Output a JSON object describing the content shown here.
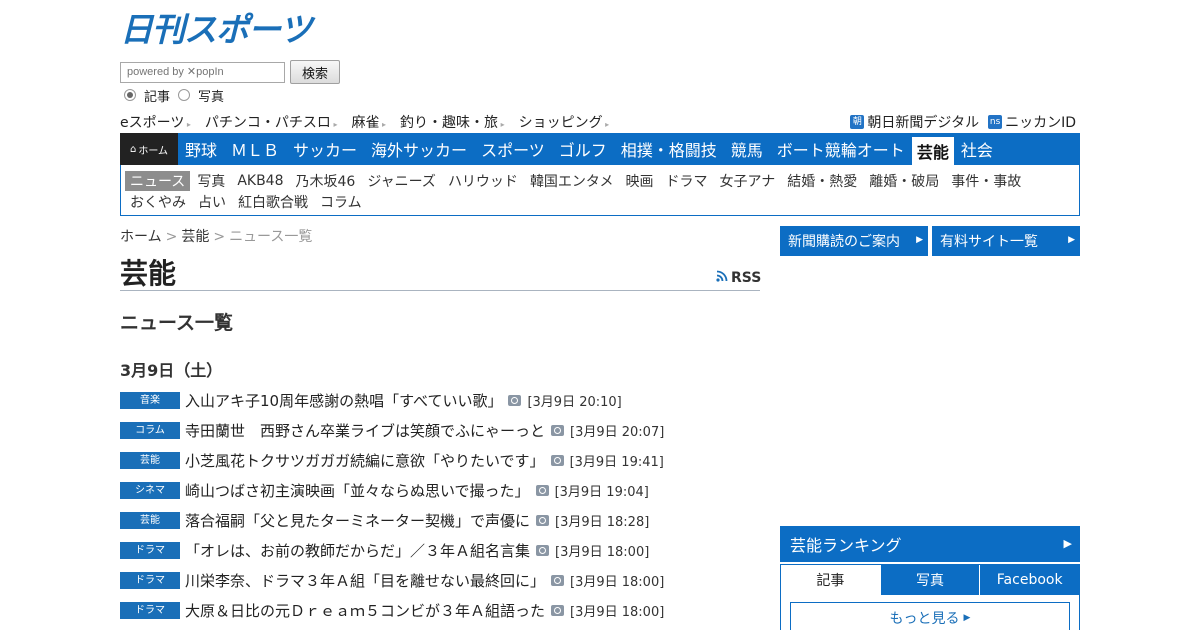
{
  "logo": {
    "text": "日刊スポーツ"
  },
  "search": {
    "placeholder": "powered by ✕popIn",
    "button_label": "検索"
  },
  "search_type": {
    "options": [
      "記事",
      "写真"
    ],
    "selected": "記事"
  },
  "util_links": [
    "eスポーツ",
    "パチンコ・パチスロ",
    "麻雀",
    "釣り・趣味・旅",
    "ショッピング"
  ],
  "util_right": [
    {
      "icon": "朝",
      "label": "朝日新聞デジタル"
    },
    {
      "icon": "ns",
      "label": "ニッカンID"
    }
  ],
  "global_nav": {
    "home_label": "ホーム",
    "items": [
      "野球",
      "ＭＬＢ",
      "サッカー",
      "海外サッカー",
      "スポーツ",
      "ゴルフ",
      "相撲・格闘技",
      "競馬",
      "ボート競輪オート",
      "芸能",
      "社会"
    ],
    "active": "芸能"
  },
  "sub_nav": {
    "row1": [
      "ニュース",
      "写真",
      "AKB48",
      "乃木坂46",
      "ジャニーズ",
      "ハリウッド",
      "韓国エンタメ",
      "映画",
      "ドラマ",
      "女子アナ",
      "結婚・熱愛",
      "離婚・破局",
      "事件・事故"
    ],
    "row2": [
      "おくやみ",
      "占い",
      "紅白歌合戦",
      "コラム"
    ],
    "active": "ニュース"
  },
  "breadcrumb": {
    "home": "ホーム",
    "section": "芸能",
    "current": "ニュース一覧",
    "separator": ">"
  },
  "page": {
    "title": "芸能",
    "rss_label": "RSS",
    "section_title": "ニュース一覧",
    "date_heading": "3月9日（土）"
  },
  "news": [
    {
      "category": "音楽",
      "headline": "入山アキ子10周年感謝の熱唱「すべていい歌」",
      "time": "[3月9日 20:10]"
    },
    {
      "category": "コラム",
      "headline": "寺田蘭世　西野さん卒業ライブは笑顔でふにゃーっと",
      "time": "[3月9日 20:07]"
    },
    {
      "category": "芸能",
      "headline": "小芝風花トクサツガガガ続編に意欲「やりたいです」",
      "time": "[3月9日 19:41]"
    },
    {
      "category": "シネマ",
      "headline": "崎山つばさ初主演映画「並々ならぬ思いで撮った」",
      "time": "[3月9日 19:04]"
    },
    {
      "category": "芸能",
      "headline": "落合福嗣「父と見たターミネーター契機」で声優に",
      "time": "[3月9日 18:28]"
    },
    {
      "category": "ドラマ",
      "headline": "「オレは、お前の教師だからだ」／３年Ａ組名言集",
      "time": "[3月9日 18:00]"
    },
    {
      "category": "ドラマ",
      "headline": "川栄李奈、ドラマ３年Ａ組「目を離せない最終回に」",
      "time": "[3月9日 18:00]"
    },
    {
      "category": "ドラマ",
      "headline": "大原＆日比の元Ｄｒｅａｍ５コンビが３年Ａ組語った",
      "time": "[3月9日 18:00]"
    }
  ],
  "sidebar": {
    "buttons": [
      "新聞購読のご案内",
      "有料サイト一覧"
    ],
    "ranking_title": "芸能ランキング",
    "ranking_tabs": [
      "記事",
      "写真",
      "Facebook"
    ],
    "ranking_active_tab": "記事",
    "more_label": "もっと見る"
  },
  "colors": {
    "brand_blue": "#0c6dc4",
    "home_tab": "#222222",
    "active_subnav": "#8d8d8d"
  }
}
